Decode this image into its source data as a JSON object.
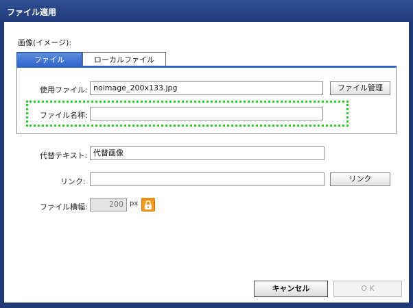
{
  "window": {
    "title": "ファイル適用"
  },
  "image_section": {
    "label": "画像(イメージ):"
  },
  "tabs": [
    {
      "label": "ファイル",
      "active": true
    },
    {
      "label": "ローカルファイル",
      "active": false
    }
  ],
  "file_tab": {
    "used_file_label": "使用ファイル:",
    "used_file_value": "noimage_200x133.jpg",
    "manage_button": "ファイル管理",
    "file_name_label": "ファイル名称:",
    "file_name_value": ""
  },
  "alt_text": {
    "label": "代替テキスト:",
    "value": "代替画像"
  },
  "link": {
    "label": "リンク:",
    "value": "",
    "button": "リンク"
  },
  "file_width": {
    "label": "ファイル横幅:",
    "value": "200",
    "unit": "px"
  },
  "buttons": {
    "cancel": "キャンセル",
    "ok": "O K"
  },
  "colors": {
    "title_bar": "#203a78",
    "active_tab": "#2f64c8",
    "highlight": "#22d422",
    "lock": "#f39a1a"
  }
}
